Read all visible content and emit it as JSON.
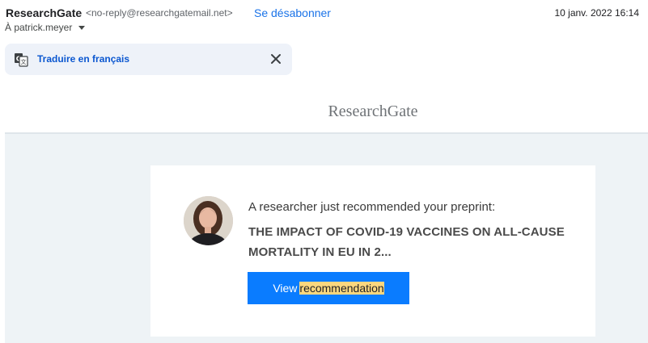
{
  "header": {
    "sender_name": "ResearchGate",
    "sender_email": "<no-reply@researchgatemail.net>",
    "unsubscribe_label": "Se désabonner",
    "date": "10 janv. 2022 16:14",
    "to_label": "À patrick.meyer"
  },
  "translate_bar": {
    "link_label": "Traduire en français",
    "icon": "translate-icon",
    "close_icon": "close-icon"
  },
  "email": {
    "brand": "ResearchGate",
    "intro": "A researcher just recommended your preprint:",
    "title_line1": "THE IMPACT OF COVID-19 VACCINES ON ALL-CAUSE",
    "title_line2": "MORTALITY IN EU IN 2...",
    "button_word1": "View",
    "button_word2": "recommendation"
  },
  "colors": {
    "accent": "#1a73e8",
    "button_bg": "#0a7cff",
    "highlight": "#fbd77e",
    "email_bg": "#eef3f6"
  }
}
